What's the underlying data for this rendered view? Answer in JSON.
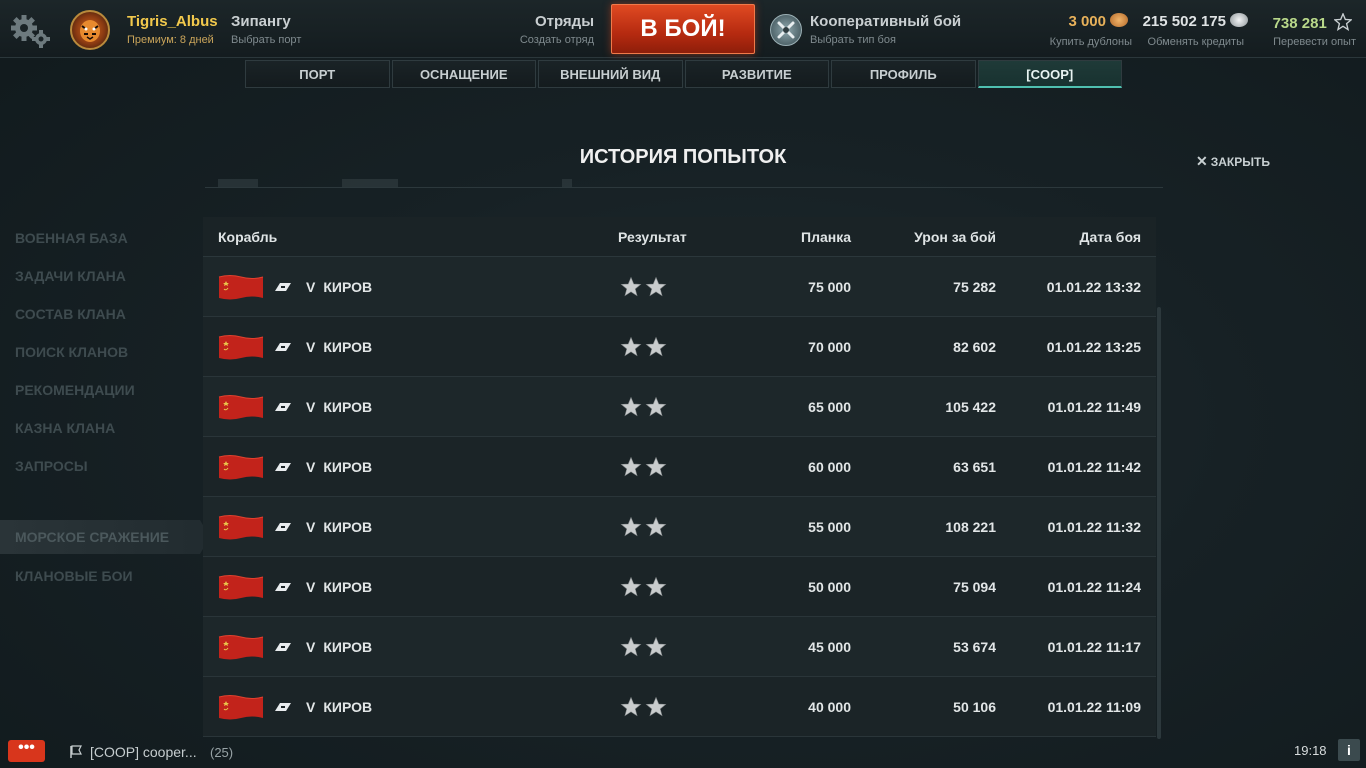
{
  "header": {
    "player_name": "Tigris_Albus",
    "premium": "Премиум: 8 дней",
    "port_name": "Зипангу",
    "port_sub": "Выбрать порт",
    "squads": "Отряды",
    "squads_sub": "Создать отряд",
    "battle_button": "В БОЙ!",
    "mode_name": "Кооперативный бой",
    "mode_sub": "Выбрать тип боя",
    "doubloons": "3 000",
    "doubloons_sub": "Купить дублоны",
    "credits": "215 502 175",
    "credits_sub": "Обменять кредиты",
    "xp": "738 281",
    "xp_sub": "Перевести опыт",
    "colors": {
      "doubloons": "#e7b15a",
      "credits": "#dfe3e4",
      "xp": "#b8d88a",
      "battle": "#c8341a"
    }
  },
  "tabs": [
    {
      "label": "ПОРТ"
    },
    {
      "label": "ОСНАЩЕНИЕ"
    },
    {
      "label": "ВНЕШНИЙ ВИД"
    },
    {
      "label": "РАЗВИТИЕ"
    },
    {
      "label": "ПРОФИЛЬ"
    },
    {
      "label": "[COOP]",
      "active": true
    }
  ],
  "left_menu": {
    "items": [
      "ВОЕННАЯ БАЗА",
      "ЗАДАЧИ КЛАНА",
      "СОСТАВ КЛАНА",
      "ПОИСК КЛАНОВ",
      "РЕКОМЕНДАЦИИ",
      "КАЗНА КЛАНА",
      "ЗАПРОСЫ"
    ],
    "active": "МОРСКОЕ СРАЖЕНИЕ",
    "last": "КЛАНОВЫЕ БОИ"
  },
  "dialog": {
    "title": "ИСТОРИЯ ПОПЫТОК",
    "close": "ЗАКРЫТЬ"
  },
  "table": {
    "headers": {
      "ship": "Корабль",
      "result": "Результат",
      "bar": "Планка",
      "damage": "Урон за бой",
      "date": "Дата боя"
    },
    "rows": [
      {
        "tier": "V",
        "ship": "КИРОВ",
        "stars": 2,
        "bar": "75 000",
        "damage": "75 282",
        "date": "01.01.22 13:32"
      },
      {
        "tier": "V",
        "ship": "КИРОВ",
        "stars": 2,
        "bar": "70 000",
        "damage": "82 602",
        "date": "01.01.22 13:25"
      },
      {
        "tier": "V",
        "ship": "КИРОВ",
        "stars": 2,
        "bar": "65 000",
        "damage": "105 422",
        "date": "01.01.22 11:49"
      },
      {
        "tier": "V",
        "ship": "КИРОВ",
        "stars": 2,
        "bar": "60 000",
        "damage": "63 651",
        "date": "01.01.22 11:42"
      },
      {
        "tier": "V",
        "ship": "КИРОВ",
        "stars": 2,
        "bar": "55 000",
        "damage": "108 221",
        "date": "01.01.22 11:32"
      },
      {
        "tier": "V",
        "ship": "КИРОВ",
        "stars": 2,
        "bar": "50 000",
        "damage": "75 094",
        "date": "01.01.22 11:24"
      },
      {
        "tier": "V",
        "ship": "КИРОВ",
        "stars": 2,
        "bar": "45 000",
        "damage": "53 674",
        "date": "01.01.22 11:17"
      },
      {
        "tier": "V",
        "ship": "КИРОВ",
        "stars": 2,
        "bar": "40 000",
        "damage": "50 106",
        "date": "01.01.22 11:09"
      }
    ]
  },
  "footer": {
    "chat_label": "•••",
    "notification": "[COOP] cooper...",
    "notification_count": "(25)",
    "clock": "19:18",
    "info_label": "i"
  }
}
